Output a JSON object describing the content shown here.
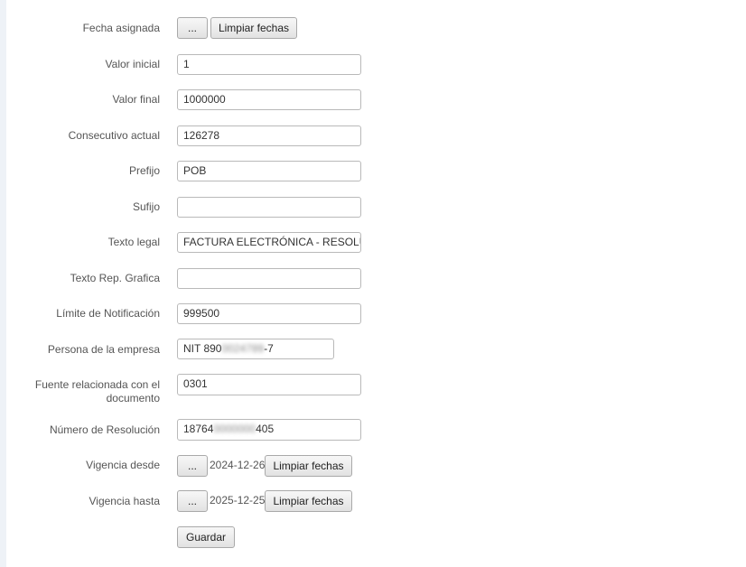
{
  "form": {
    "fecha_asignada": {
      "label": "Fecha asignada",
      "dots_label": "...",
      "clear_label": "Limpiar fechas"
    },
    "valor_inicial": {
      "label": "Valor inicial",
      "value": "1"
    },
    "valor_final": {
      "label": "Valor final",
      "value": "1000000"
    },
    "consecutivo_actual": {
      "label": "Consecutivo actual",
      "value": "126278"
    },
    "prefijo": {
      "label": "Prefijo",
      "value": "POB"
    },
    "sufijo": {
      "label": "Sufijo",
      "value": ""
    },
    "texto_legal": {
      "label": "Texto legal",
      "value": "FACTURA ELECTRÓNICA - RESOLUCIÓN"
    },
    "texto_rep_grafica": {
      "label": "Texto Rep. Grafica",
      "value": ""
    },
    "limite_notificacion": {
      "label": "Límite de Notificación",
      "value": "999500"
    },
    "persona_empresa": {
      "label": "Persona de la empresa",
      "value_prefix": "NIT 890",
      "value_redacted": "0024789",
      "value_suffix": "-7"
    },
    "fuente_relacionada": {
      "label_line1": "Fuente relacionada con el",
      "label_line2": "documento",
      "value": "0301"
    },
    "numero_resolucion": {
      "label": "Número de Resolución",
      "value_prefix": "18764",
      "value_redacted": "0000000",
      "value_suffix": "405"
    },
    "vigencia_desde": {
      "label": "Vigencia desde",
      "dots_label": "...",
      "date": "2024-12-26",
      "clear_label": "Limpiar fechas"
    },
    "vigencia_hasta": {
      "label": "Vigencia hasta",
      "dots_label": "...",
      "date": "2025-12-25",
      "clear_label": "Limpiar fechas"
    },
    "save_label": "Guardar"
  }
}
